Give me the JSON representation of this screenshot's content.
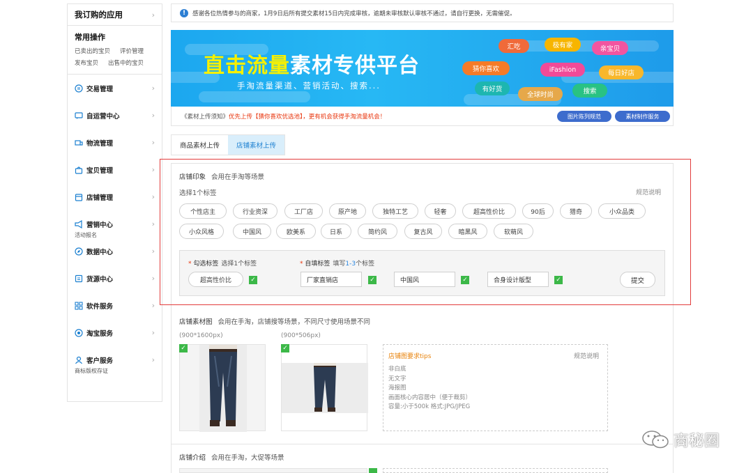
{
  "sidebar": {
    "header": "我订购的应用",
    "common": {
      "title": "常用操作",
      "links": [
        "已卖出的宝贝",
        "评价管理",
        "发布宝贝",
        "出售中的宝贝"
      ]
    },
    "items": [
      {
        "label": "交易管理",
        "icon": "exchange-icon"
      },
      {
        "label": "自运营中心",
        "icon": "chat-icon"
      },
      {
        "label": "物流管理",
        "icon": "truck-icon"
      },
      {
        "label": "宝贝管理",
        "icon": "bag-icon"
      },
      {
        "label": "店铺管理",
        "icon": "store-icon"
      },
      {
        "label": "营销中心",
        "icon": "megaphone-icon",
        "sub": "活动报名"
      },
      {
        "label": "数据中心",
        "icon": "compass-icon"
      },
      {
        "label": "货源中心",
        "icon": "box-icon"
      },
      {
        "label": "软件服务",
        "icon": "grid-icon"
      },
      {
        "label": "淘宝服务",
        "icon": "target-icon"
      },
      {
        "label": "客户服务",
        "icon": "person-icon",
        "sub": "商标版权存证"
      }
    ]
  },
  "notice": "感谢各位热情参与的商家，1月9日后所有提交素材15日内完成审核，逾期未审核默认审核不通过，请自行更换，无需催促。",
  "banner": {
    "title_hl": "直击流量",
    "title_rest": "素材专供平台",
    "subtitle": "手淘流量渠道、营销活动、搜索...",
    "pills": [
      "汇吃",
      "极有家",
      "亲宝贝",
      "猜你喜欢",
      "iFashion",
      "每日好店",
      "有好货",
      "全球时尚",
      "搜索"
    ]
  },
  "upload_note": {
    "prefix": "《素材上传须知》",
    "red": "优先上传【猜你喜欢优选池】，更有机会获得手淘流量机会！",
    "btn1": "图片陈列规范",
    "btn2": "素材制作服务"
  },
  "tabs": [
    "商品素材上传",
    "店铺素材上传"
  ],
  "section1": {
    "title": "店铺印象",
    "desc": "会用在手淘等场景",
    "prompt": "选择1个标签",
    "spec_link": "规范说明",
    "tags_row1": [
      "个性店主",
      "行业资深",
      "工厂店",
      "原产地",
      "独特工艺",
      "轻奢",
      "超高性价比",
      "90后",
      "猎奇",
      "小众品类"
    ],
    "tags_row2": [
      "小众风格",
      "中国风",
      "欧美系",
      "日系",
      "简约风",
      "复古风",
      "暗黑风",
      "软萌风"
    ],
    "checked_label": "勾选标签",
    "checked_hint": "选择1个标签",
    "custom_label": "自填标签",
    "custom_hint_a": "填写",
    "custom_hint_b": "1-3",
    "custom_hint_c": "个标签",
    "checked_value": "超高性价比",
    "custom_values": [
      "厂家直销店",
      "中国风",
      "合身设计版型"
    ],
    "submit": "提交"
  },
  "section2": {
    "title": "店铺素材图",
    "desc": "会用在手淘，店铺搜等场景，不同尺寸使用场景不同",
    "size1": "(900*1600px)",
    "size2": "(900*506px)",
    "tips_title": "店铺图要求tips",
    "tips_link": "规范说明",
    "tips": [
      "非白底",
      "无文字",
      "海报图",
      "画面核心内容居中（便于裁剪）",
      "容量:小于500k 格式:JPG/JPEG"
    ]
  },
  "section3": {
    "title": "店铺介绍",
    "desc": "会用在手淘，大促等场景"
  },
  "watermark": "商秘圈",
  "colors": {
    "accent": "#1a7fd0",
    "red": "#e8340c",
    "check": "#3cb848",
    "highlight_border": "#e23b3b"
  }
}
